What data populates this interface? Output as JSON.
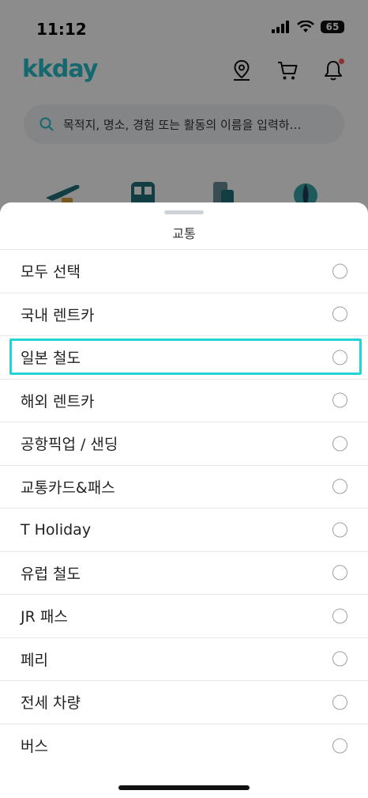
{
  "status_bar": {
    "time": "11:12",
    "battery": "65"
  },
  "header": {
    "logo": "kkday"
  },
  "search": {
    "placeholder": "목적지, 명소, 경험 또는 활동의 이름을 입력하…"
  },
  "sheet": {
    "title": "교통",
    "items": [
      {
        "label": "모두 선택"
      },
      {
        "label": "국내 렌트카"
      },
      {
        "label": "일본 철도"
      },
      {
        "label": "해외 렌트카"
      },
      {
        "label": "공항픽업 / 샌딩"
      },
      {
        "label": "교통카드&패스"
      },
      {
        "label": "T Holiday"
      },
      {
        "label": "유럽 철도"
      },
      {
        "label": "JR 패스"
      },
      {
        "label": "페리"
      },
      {
        "label": "전세 차량"
      },
      {
        "label": "버스"
      }
    ],
    "highlighted_item": "일본 철도"
  },
  "colors": {
    "brand": "#26bec9",
    "highlight": "#23d3d6",
    "notification": "#ff5a5f"
  }
}
